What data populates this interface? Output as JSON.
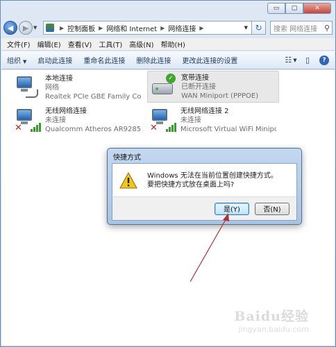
{
  "window": {
    "caption_buttons": [
      "▭",
      "▢",
      "✕"
    ]
  },
  "address_bar": {
    "crumbs": [
      "控制面板",
      "网络和 Internet",
      "网络连接"
    ],
    "search_placeholder": "搜索 网络连接"
  },
  "menu": {
    "items": [
      "文件(F)",
      "编辑(E)",
      "查看(V)",
      "工具(T)",
      "高级(N)",
      "帮助(H)"
    ]
  },
  "commands": {
    "organize": "组织",
    "start_connection": "启动此连接",
    "rename_connection": "重命名此连接",
    "delete_connection": "删除此连接",
    "change_settings": "更改此连接的设置"
  },
  "connections": [
    {
      "name": "本地连接",
      "status": "网络",
      "device": "Realtek PCIe GBE Family Contr..."
    },
    {
      "name": "宽带连接",
      "status": "已断开连接",
      "device": "WAN Miniport (PPPOE)"
    },
    {
      "name": "无线网络连接",
      "status": "未连接",
      "device": "Qualcomm Atheros AR9285 80..."
    },
    {
      "name": "无线网络连接 2",
      "status": "未连接",
      "device": "Microsoft Virtual WiFi Miniport..."
    }
  ],
  "dialog": {
    "title": "快捷方式",
    "message_line1": "Windows 无法在当前位置创建快捷方式。",
    "message_line2": "要把快捷方式放在桌面上吗?",
    "yes_label": "是(Y)",
    "no_label": "否(N)"
  },
  "watermark": {
    "logo": "Baidu经验",
    "url": "jingyan.baidu.com"
  },
  "colors": {
    "annotation_arrow": "#b03030",
    "accent": "#2b6fb6"
  }
}
